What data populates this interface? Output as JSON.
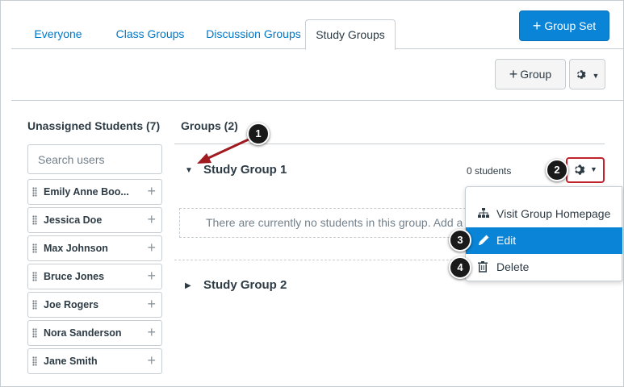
{
  "tabs": [
    {
      "label": "Everyone"
    },
    {
      "label": "Class Groups"
    },
    {
      "label": "Discussion Groups"
    },
    {
      "label": "Study Groups"
    }
  ],
  "toolbar": {
    "group_set_label": "Group Set",
    "group_label": "Group"
  },
  "unassigned": {
    "title": "Unassigned Students (7)",
    "search_placeholder": "Search users",
    "students": [
      {
        "name": "Emily Anne Boo..."
      },
      {
        "name": "Jessica Doe"
      },
      {
        "name": "Max Johnson"
      },
      {
        "name": "Bruce Jones"
      },
      {
        "name": "Joe Rogers"
      },
      {
        "name": "Nora Sanderson"
      },
      {
        "name": "Jane Smith"
      }
    ]
  },
  "groups": {
    "title": "Groups (2)",
    "items": [
      {
        "name": "Study Group 1",
        "count": "0 students",
        "empty_text": "There are currently no students in this group. Add a s"
      },
      {
        "name": "Study Group 2"
      }
    ]
  },
  "menu": {
    "items": [
      {
        "label": "Visit Group Homepage",
        "icon": "sitemap-icon"
      },
      {
        "label": "Edit",
        "icon": "pencil-icon"
      },
      {
        "label": "Delete",
        "icon": "trash-icon"
      }
    ]
  },
  "callouts": [
    "1",
    "2",
    "3",
    "4"
  ],
  "colors": {
    "link": "#0077c7",
    "primary": "#0a84d6",
    "callout_highlight": "#c0212a",
    "text": "#2d3b45"
  }
}
